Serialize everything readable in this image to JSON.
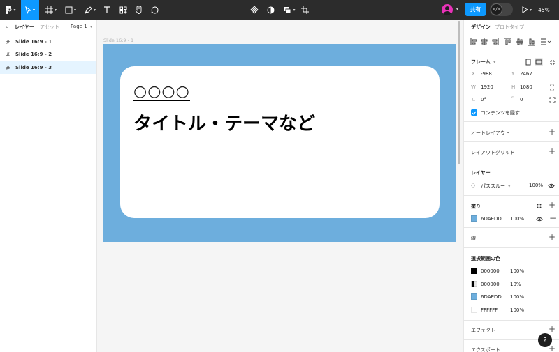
{
  "toolbar": {
    "share_label": "共有",
    "zoom": "45%",
    "dev_mode_glyph": "</>",
    "icons": [
      "figma-menu-icon",
      "move-tool-icon",
      "frame-tool-icon",
      "shape-tool-icon",
      "pen-tool-icon",
      "text-tool-icon",
      "resources-icon",
      "hand-tool-icon",
      "comment-tool-icon",
      "component-icon",
      "mask-icon",
      "boolean-icon",
      "crop-icon",
      "present-icon"
    ]
  },
  "left_panel": {
    "tab_layers": "レイヤー",
    "tab_assets": "アセット",
    "page_selector": "Page 1",
    "layers": [
      {
        "label": "Slide 16:9 - 1"
      },
      {
        "label": "Slide 16:9 - 2"
      },
      {
        "label": "Slide 16:9 - 3"
      }
    ]
  },
  "canvas": {
    "frame_label": "Slide 16:9 - 1",
    "slide": {
      "placeholder_circles": "○○○○",
      "title": "タイトル・テーマなど",
      "background_color": "#6DAEDD"
    }
  },
  "right_panel": {
    "tab_design": "デザイン",
    "tab_prototype": "プロトタイプ",
    "frame": {
      "title": "フレーム",
      "x_label": "X",
      "x_value": "-988",
      "y_label": "Y",
      "y_value": "2467",
      "w_label": "W",
      "w_value": "1920",
      "h_label": "H",
      "h_value": "1080",
      "rotation": "0°",
      "radius": "0",
      "clip_content_label": "コンテンツを隠す"
    },
    "auto_layout": "オートレイアウト",
    "layout_grid": "レイアウトグリッド",
    "layer": {
      "title": "レイヤー",
      "blend_mode": "パススルー",
      "opacity": "100%"
    },
    "fill": {
      "title": "塗り",
      "hex": "6DAEDD",
      "opacity": "100%",
      "color": "#6DAEDD"
    },
    "stroke": "線",
    "selection_colors": {
      "title": "選択範囲の色",
      "items": [
        {
          "hex": "000000",
          "opacity": "100%",
          "color": "#000000"
        },
        {
          "hex": "000000",
          "opacity": "10%",
          "color": "#000000"
        },
        {
          "hex": "6DAEDD",
          "opacity": "100%",
          "color": "#6DAEDD"
        },
        {
          "hex": "FFFFFF",
          "opacity": "100%",
          "color": "#FFFFFF"
        }
      ]
    },
    "effects": "エフェクト",
    "export": "エクスポート"
  },
  "help_label": "?"
}
